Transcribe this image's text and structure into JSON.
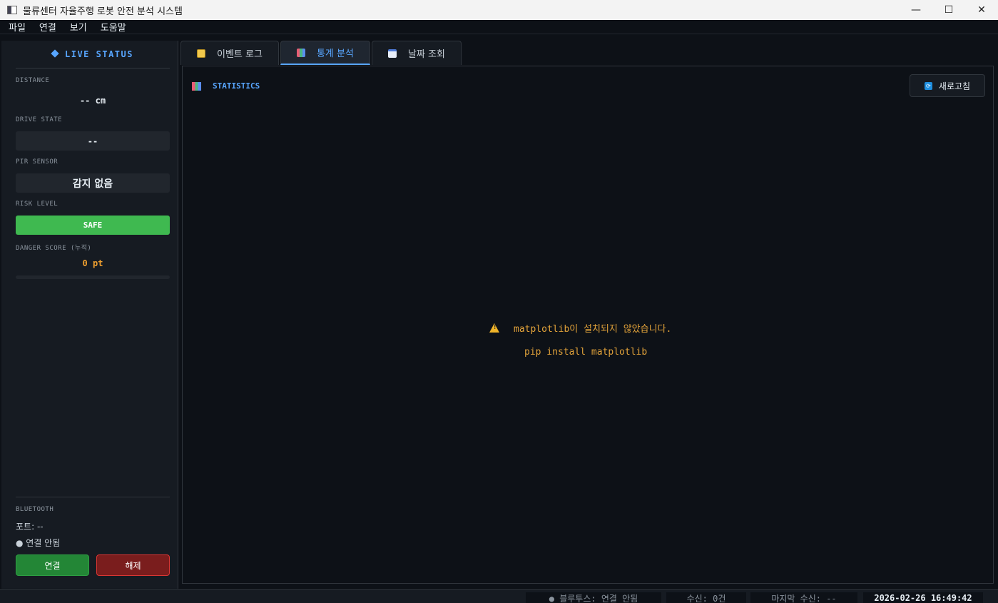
{
  "window": {
    "title": "물류센터 자율주행 로봇 안전 분석 시스템",
    "minimize": "—",
    "maximize": "☐",
    "close": "✕"
  },
  "menu": [
    "파일",
    "연결",
    "보기",
    "도움말"
  ],
  "sidebar": {
    "title": "LIVE STATUS",
    "distance_label": "DISTANCE",
    "distance_value": "-- cm",
    "drive_label": "DRIVE STATE",
    "drive_value": "--",
    "pir_label": "PIR SENSOR",
    "pir_value": "감지 없음",
    "risk_label": "RISK LEVEL",
    "risk_value": "SAFE",
    "risk_color": "#3fb950",
    "score_label": "DANGER SCORE (누적)",
    "score_value": "0 pt",
    "score_fraction": 0,
    "bluetooth_label": "BLUETOOTH",
    "port_text": "포트: --",
    "conn_status": "● 연결 안됨",
    "connect_button": "연결",
    "disconnect_button": "해제"
  },
  "tabs": [
    {
      "label": "이벤트 로그",
      "icon": "clipboard-icon",
      "active": false
    },
    {
      "label": "통계 분석",
      "icon": "bar-chart-icon",
      "active": true
    },
    {
      "label": "날짜 조회",
      "icon": "calendar-icon",
      "active": false
    }
  ],
  "panel": {
    "title": "STATISTICS",
    "refresh_button": "새로고침",
    "warning": "matplotlib이 설치되지 않았습니다.",
    "hint": "pip install matplotlib"
  },
  "statusbar": {
    "bluetooth": "● 블루투스: 연결 안됨",
    "received": "수신: 0건",
    "last_received": "마지막 수신: --",
    "datetime": "2026-02-26  16:49:42"
  }
}
